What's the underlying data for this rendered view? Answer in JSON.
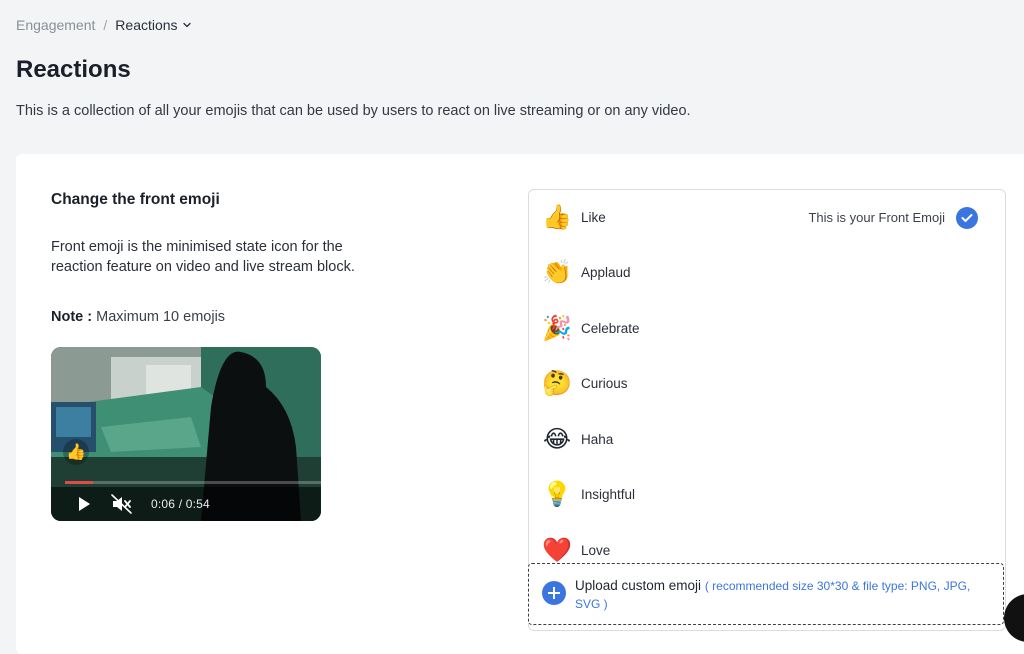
{
  "breadcrumb": {
    "parent": "Engagement",
    "separator": "/",
    "current": "Reactions"
  },
  "header": {
    "title": "Reactions",
    "description": "This is a collection of all your emojis that can be used by users to react on live streaming or on any video."
  },
  "front_emoji": {
    "title": "Change the front emoji",
    "description": "Front emoji is the minimised state icon for the reaction feature on video and live stream block.",
    "note_label": "Note :",
    "note_text": "Maximum 10 emojis"
  },
  "video": {
    "time": "0:06 / 0:54",
    "progress": 0.11,
    "overlay_emoji": "👍"
  },
  "reactions": [
    {
      "emoji": "👍",
      "label": "Like",
      "front_tag": "This is your Front Emoji"
    },
    {
      "emoji": "👏",
      "label": "Applaud"
    },
    {
      "emoji": "🎉",
      "label": "Celebrate"
    },
    {
      "emoji": "🤔",
      "label": "Curious"
    },
    {
      "emoji": "😂",
      "label": "Haha"
    },
    {
      "emoji": "💡",
      "label": "Insightful"
    },
    {
      "emoji": "❤️",
      "label": "Love"
    }
  ],
  "upload": {
    "label": "Upload custom emoji",
    "hint": "( recommended size 30*30 & file type: PNG, JPG, SVG )"
  },
  "colors": {
    "accent": "#3b75e0",
    "progress": "#e24a4a",
    "background": "#f3f4f6"
  }
}
